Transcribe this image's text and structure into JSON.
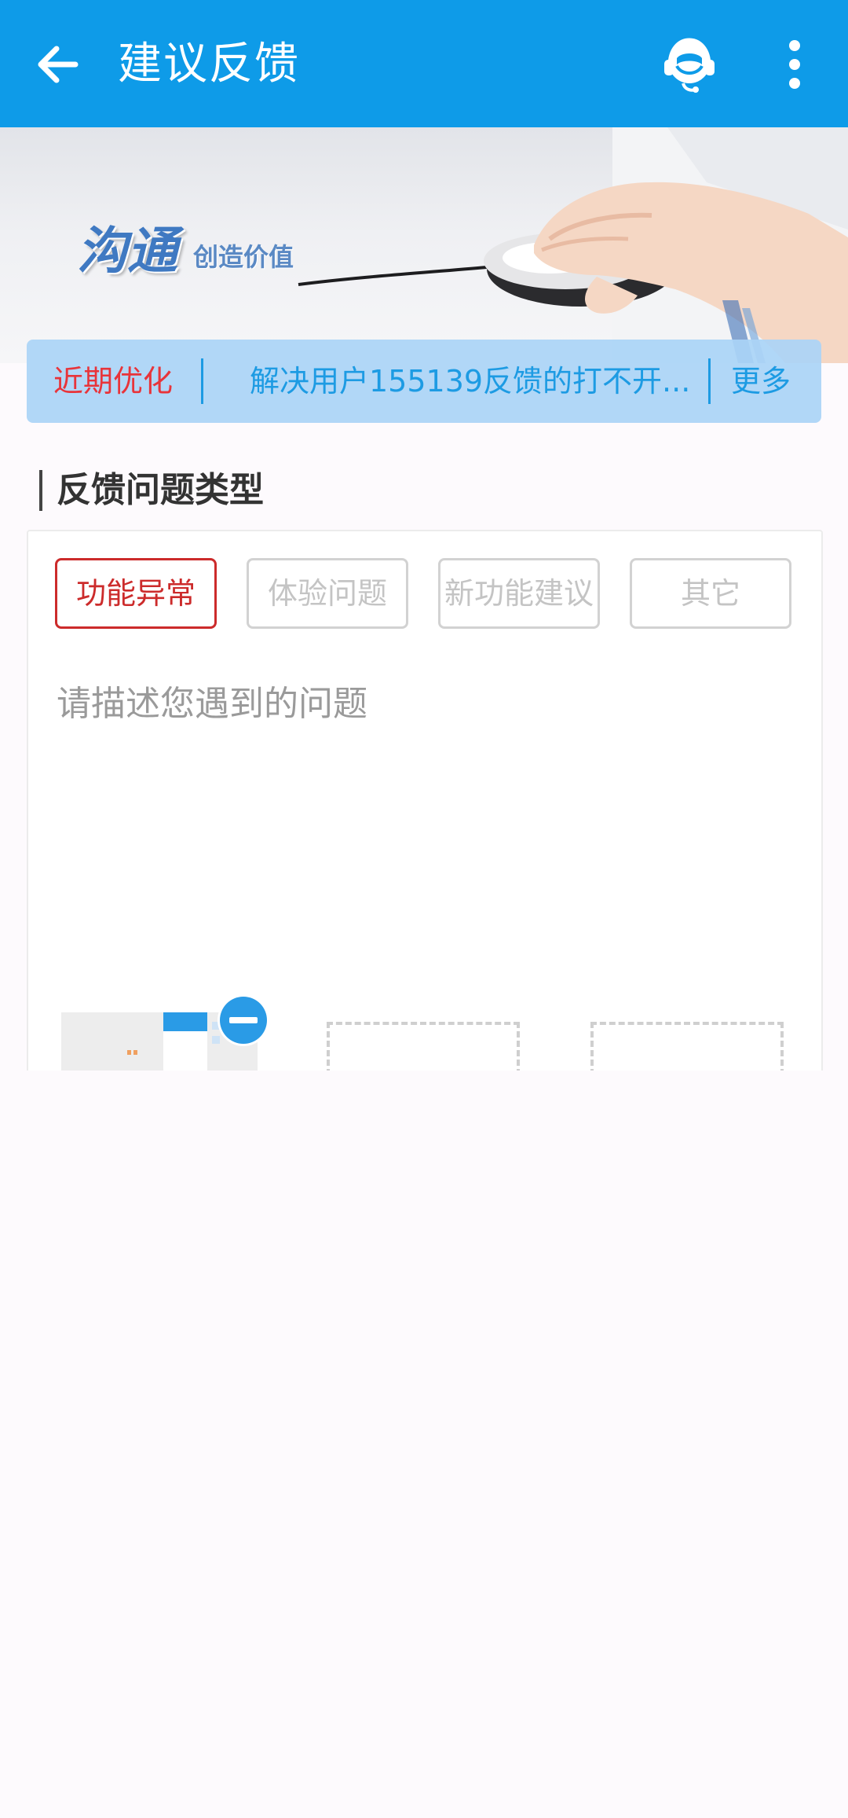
{
  "appbar": {
    "title": "建议反馈",
    "back_icon": "arrow-left-icon",
    "support_icon": "customer-service-headset-icon",
    "more_icon": "more-vertical-icon",
    "bg_color": "#0e9be8"
  },
  "banner": {
    "slogan_main": "沟通",
    "slogan_sub": "创造价值"
  },
  "notice": {
    "label": "近期优化",
    "text": "解决用户155139反馈的打不开...",
    "more": "更多",
    "label_color": "#e8343a",
    "text_color": "#1d9be3"
  },
  "section": {
    "title": "反馈问题类型"
  },
  "types": [
    {
      "label": "功能异常",
      "selected": true
    },
    {
      "label": "体验问题",
      "selected": false
    },
    {
      "label": "新功能建议",
      "selected": false
    },
    {
      "label": "其它",
      "selected": false
    }
  ],
  "description": {
    "placeholder": "请描述您遇到的问题",
    "value": ""
  },
  "attachments": {
    "remove_icon": "minus-circle-icon",
    "thumb_icon": "screenshot-thumbnail",
    "empty_slot_icon": "add-image-slot"
  }
}
